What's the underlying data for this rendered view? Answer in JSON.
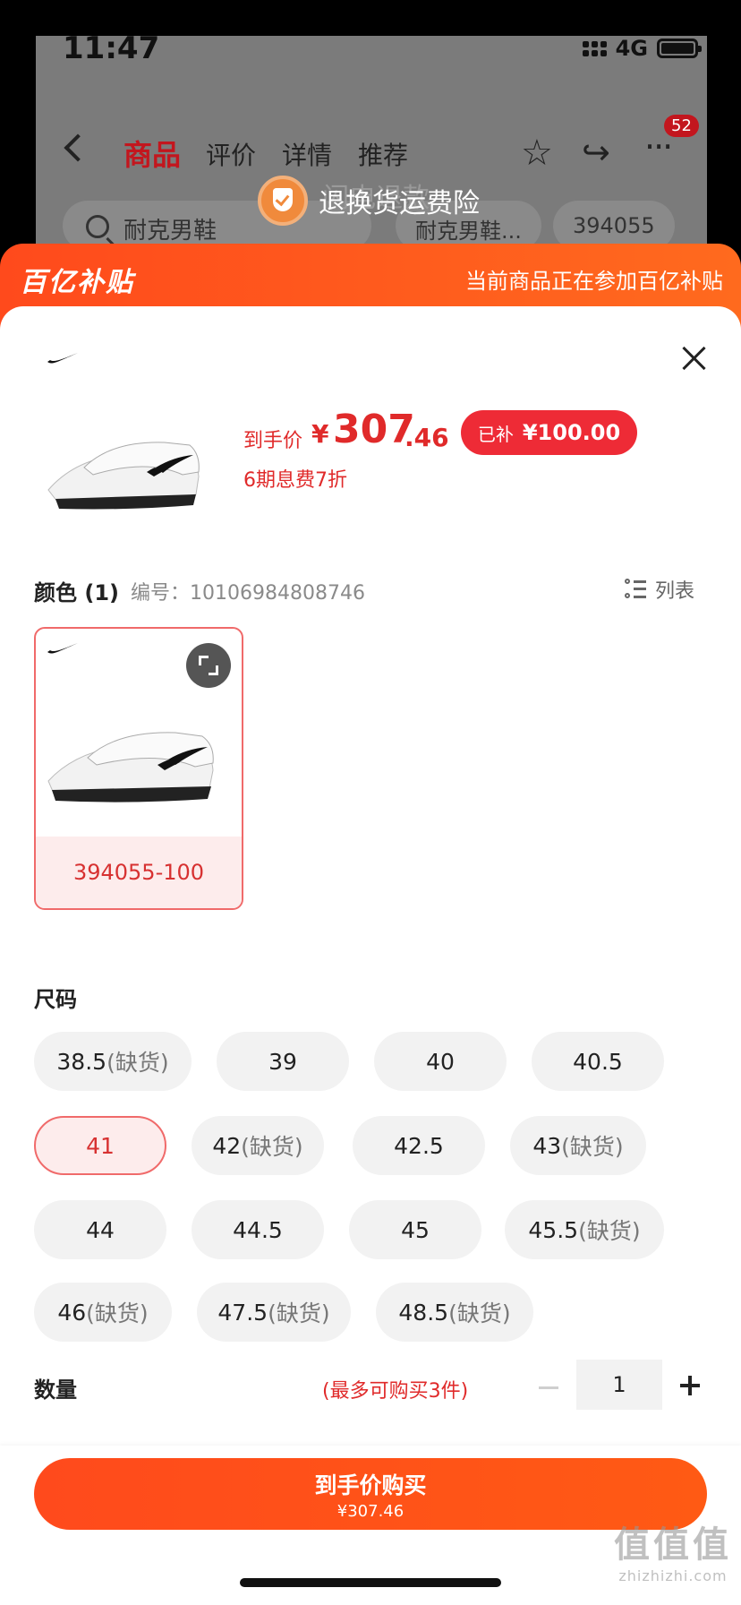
{
  "status_bar": {
    "time": "11:47",
    "network": "4G"
  },
  "nav": {
    "tabs": [
      "商品",
      "评价",
      "详情",
      "推荐"
    ],
    "active_tab": "商品",
    "cart_badge": "52"
  },
  "search": {
    "placeholder": "耐克男鞋",
    "chips": [
      "耐克男鞋...",
      "394055"
    ]
  },
  "toast": {
    "text": "退换货运费险",
    "ghost_text": "闪电退款"
  },
  "promo": {
    "logo": "百亿补贴",
    "note": "当前商品正在参加百亿补贴"
  },
  "product": {
    "price_label": "到手价",
    "currency": "¥",
    "price_int": "307",
    "price_dec": ".46",
    "subsidy_label": "已补",
    "subsidy_amount": "¥100.00",
    "installment": "6期息费7折"
  },
  "color_section": {
    "title": "颜色",
    "count": "(1)",
    "sku_code": "编号：10106984808746",
    "view_toggle": "列表",
    "options": [
      {
        "label": "394055-100"
      }
    ]
  },
  "size_section": {
    "title": "尺码",
    "options": [
      {
        "size": "38.5",
        "note": "(缺货)"
      },
      {
        "size": "39",
        "note": ""
      },
      {
        "size": "40",
        "note": ""
      },
      {
        "size": "40.5",
        "note": ""
      },
      {
        "size": "41",
        "note": ""
      },
      {
        "size": "42",
        "note": "(缺货)"
      },
      {
        "size": "42.5",
        "note": ""
      },
      {
        "size": "43",
        "note": "(缺货)"
      },
      {
        "size": "44",
        "note": ""
      },
      {
        "size": "44.5",
        "note": ""
      },
      {
        "size": "45",
        "note": ""
      },
      {
        "size": "45.5",
        "note": "(缺货)"
      },
      {
        "size": "46",
        "note": "(缺货)"
      },
      {
        "size": "47.5",
        "note": "(缺货)"
      },
      {
        "size": "48.5",
        "note": "(缺货)"
      }
    ],
    "selected": "41"
  },
  "quantity": {
    "title": "数量",
    "limit": "(最多可购买3件)",
    "value": "1"
  },
  "buy": {
    "label": "到手价购买",
    "price": "¥307.46"
  },
  "watermark": {
    "main": "值值值",
    "sub": "zhizhizhi.com"
  },
  "colors": {
    "accent": "#ff4a1c",
    "price_red": "#e02a2a",
    "selected_border": "#f06a6a"
  }
}
